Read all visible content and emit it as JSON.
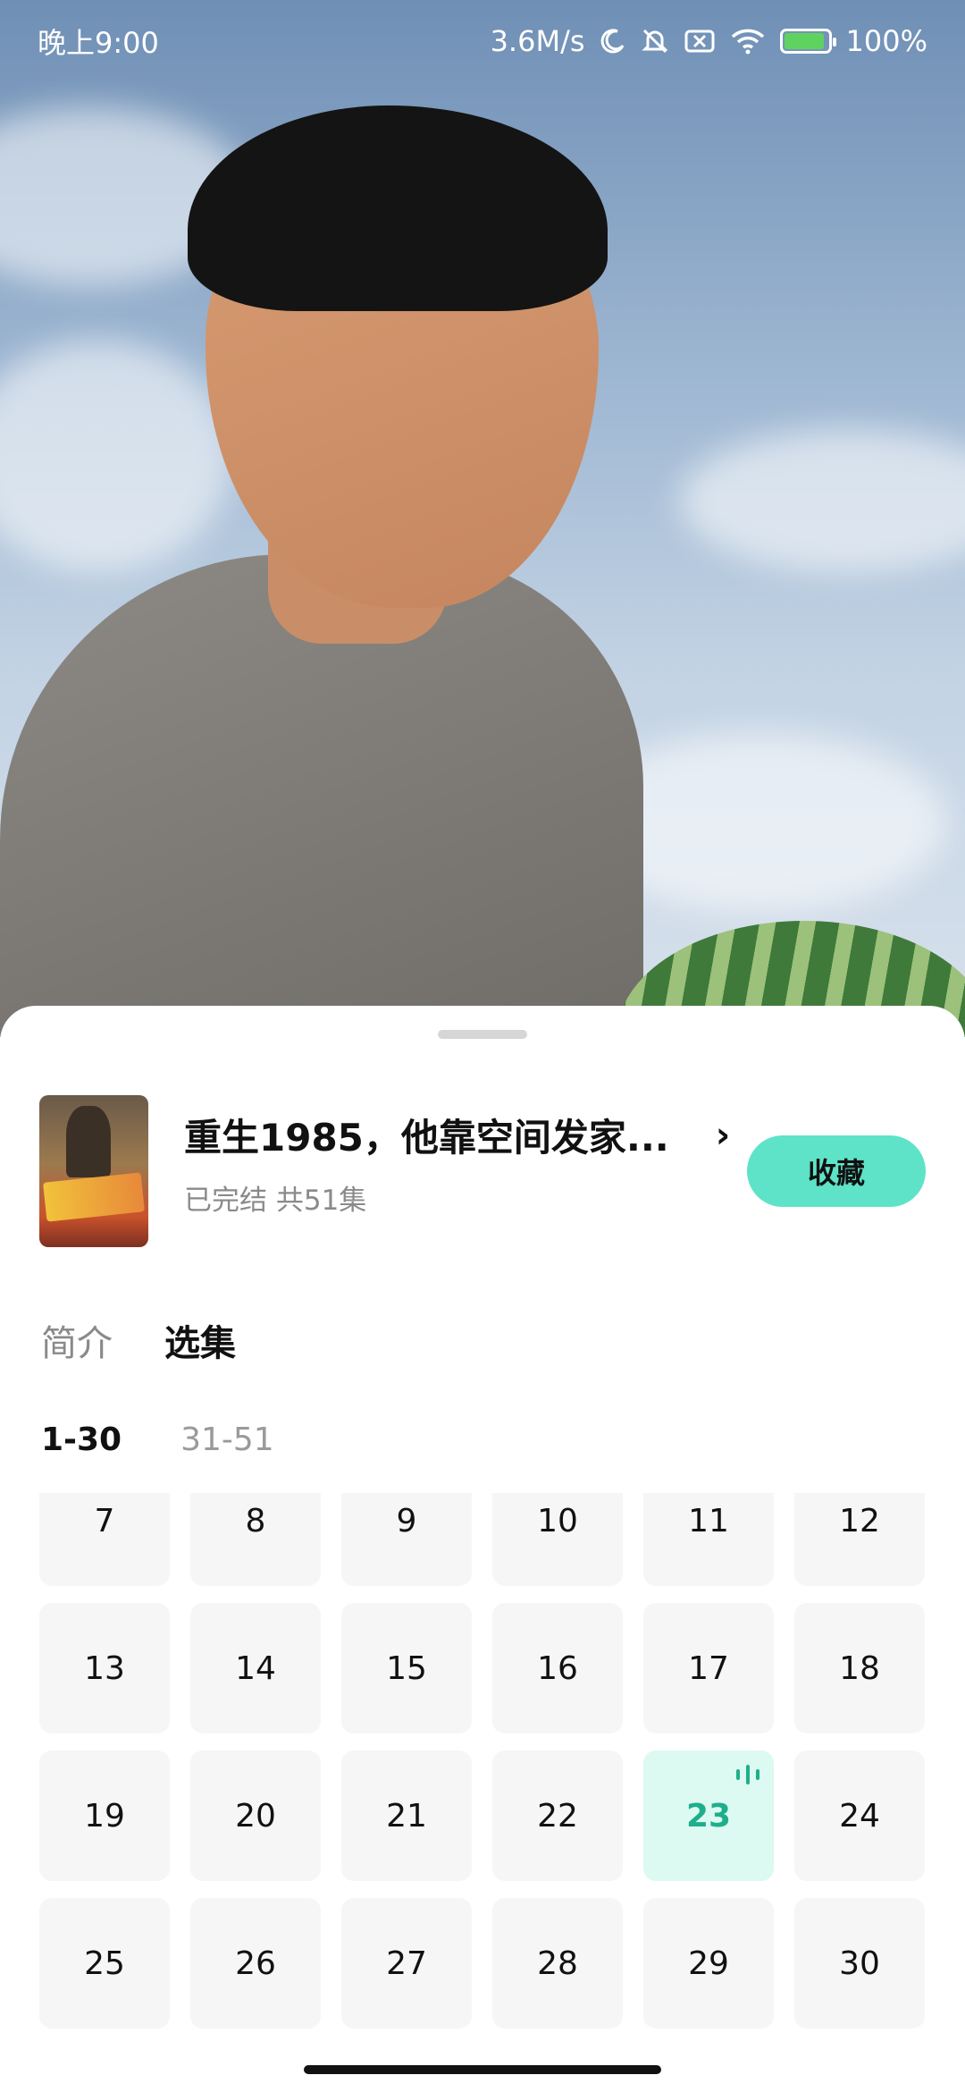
{
  "status_bar": {
    "time": "晚上9:00",
    "network_speed": "3.6M/s",
    "battery": "100%",
    "icons": [
      "moon-icon",
      "bell-off-icon",
      "sim-off-icon",
      "wifi-icon",
      "battery-charging-icon"
    ]
  },
  "drama": {
    "title": "重生1985，他靠空间发家...",
    "status": "已完结 共51集",
    "favorite_label": "收藏"
  },
  "tabs": [
    {
      "label": "简介",
      "active": false
    },
    {
      "label": "选集",
      "active": true
    }
  ],
  "ranges": [
    {
      "label": "1-30",
      "active": true
    },
    {
      "label": "31-51",
      "active": false
    }
  ],
  "episodes": [
    "7",
    "8",
    "9",
    "10",
    "11",
    "12",
    "13",
    "14",
    "15",
    "16",
    "17",
    "18",
    "19",
    "20",
    "21",
    "22",
    "23",
    "24",
    "25",
    "26",
    "27",
    "28",
    "29",
    "30"
  ],
  "current_episode": "23",
  "colors": {
    "accent": "#5ee3c8",
    "accent_text": "#1fae8c",
    "current_bg": "#dcf9f2"
  }
}
